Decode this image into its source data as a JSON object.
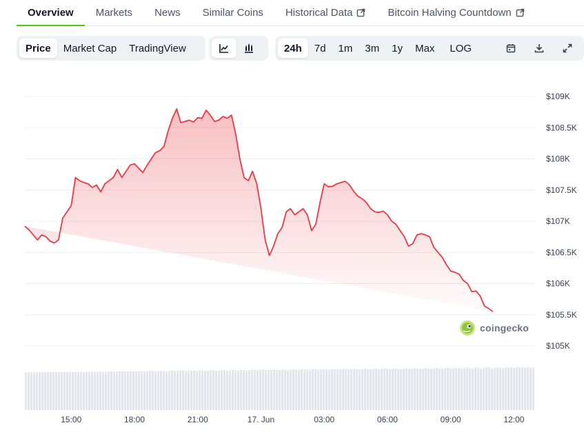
{
  "tabs": [
    {
      "label": "Overview",
      "active": true,
      "external": false
    },
    {
      "label": "Markets",
      "active": false,
      "external": false
    },
    {
      "label": "News",
      "active": false,
      "external": false
    },
    {
      "label": "Similar Coins",
      "active": false,
      "external": false
    },
    {
      "label": "Historical Data",
      "active": false,
      "external": true
    },
    {
      "label": "Bitcoin Halving Countdown",
      "active": false,
      "external": true
    }
  ],
  "toolbar": {
    "metric_tabs": [
      {
        "label": "Price",
        "selected": true
      },
      {
        "label": "Market Cap",
        "selected": false
      },
      {
        "label": "TradingView",
        "selected": false
      }
    ],
    "chart_style_icons": [
      {
        "icon": "line-chart-icon",
        "selected": true
      },
      {
        "icon": "candlestick-chart-icon",
        "selected": false
      }
    ],
    "ranges": [
      {
        "label": "24h",
        "selected": true
      },
      {
        "label": "7d",
        "selected": false
      },
      {
        "label": "1m",
        "selected": false
      },
      {
        "label": "3m",
        "selected": false
      },
      {
        "label": "1y",
        "selected": false
      },
      {
        "label": "Max",
        "selected": false
      },
      {
        "label": "LOG",
        "selected": false
      }
    ],
    "action_icons": [
      "calendar-icon",
      "download-icon",
      "fullscreen-icon"
    ]
  },
  "watermark": {
    "text": "coingecko",
    "icon": "coingecko-logo-icon"
  },
  "colors": {
    "line": "#ea3943",
    "fill": "#ea3943",
    "volume": "#e3e6ea",
    "active_tab_underline": "#4bcc00"
  },
  "chart_data": {
    "type": "area",
    "y_axis": {
      "min": 105000,
      "max": 109000,
      "ticks": [
        109000,
        108500,
        108000,
        107500,
        107000,
        106500,
        106000,
        105500,
        105000
      ],
      "tick_labels": [
        "$109K",
        "$108.5K",
        "$108K",
        "$107.5K",
        "$107K",
        "$106.5K",
        "$106K",
        "$105.5K",
        "$105K"
      ],
      "position": "right"
    },
    "x_axis": {
      "range_hours": [
        0,
        24.2
      ],
      "tick_hours": [
        2.2,
        5.2,
        8.2,
        11.2,
        14.2,
        17.2,
        20.2,
        23.2
      ],
      "tick_labels": [
        "15:00",
        "18:00",
        "21:00",
        "17. Jun",
        "03:00",
        "06:00",
        "09:00",
        "12:00"
      ]
    },
    "grid": true,
    "price": {
      "x_hours": [
        0,
        0.2,
        0.4,
        0.6,
        0.8,
        1.0,
        1.2,
        1.4,
        1.6,
        1.8,
        2.0,
        2.2,
        2.4,
        2.6,
        2.8,
        3.0,
        3.2,
        3.4,
        3.6,
        3.8,
        4.0,
        4.2,
        4.4,
        4.6,
        4.8,
        5.0,
        5.2,
        5.4,
        5.6,
        5.8,
        6.0,
        6.2,
        6.4,
        6.6,
        6.8,
        7.0,
        7.2,
        7.4,
        7.6,
        7.8,
        8.0,
        8.2,
        8.4,
        8.6,
        8.8,
        9.0,
        9.2,
        9.4,
        9.6,
        9.8,
        10.0,
        10.2,
        10.4,
        10.6,
        10.8,
        11.0,
        11.2,
        11.4,
        11.6,
        11.8,
        12.0,
        12.2,
        12.4,
        12.6,
        12.8,
        13.0,
        13.2,
        13.4,
        13.6,
        13.8,
        14.0,
        14.2,
        14.4,
        14.6,
        14.8,
        15.0,
        15.2,
        15.4,
        15.6,
        15.8,
        16.0,
        16.2,
        16.4,
        16.6,
        16.8,
        17.0,
        17.2,
        17.4,
        17.6,
        17.8,
        18.0,
        18.2,
        18.4,
        18.6,
        18.8,
        19.0,
        19.2,
        19.4,
        19.6,
        19.8,
        20.0,
        20.2,
        20.4,
        20.6,
        20.8,
        21.0,
        21.2,
        21.4,
        21.6,
        21.8,
        22.0,
        22.2,
        22.4,
        22.6,
        22.8,
        23.0,
        23.2,
        23.4,
        23.6,
        23.8,
        24.0,
        24.2
      ],
      "values": [
        106920,
        106860,
        106780,
        106700,
        106780,
        106750,
        106680,
        106650,
        106700,
        107050,
        107150,
        107250,
        107700,
        107650,
        107620,
        107600,
        107540,
        107580,
        107470,
        107600,
        107650,
        107700,
        107830,
        107700,
        107800,
        107900,
        107920,
        107850,
        107780,
        107900,
        108000,
        108100,
        108130,
        108200,
        108450,
        108650,
        108800,
        108580,
        108600,
        108620,
        108590,
        108660,
        108650,
        108780,
        108700,
        108600,
        108620,
        108680,
        108650,
        108700,
        108400,
        108000,
        107700,
        107650,
        107800,
        107600,
        107200,
        106700,
        106450,
        106600,
        106800,
        106900,
        107150,
        107200,
        107100,
        107150,
        107200,
        107100,
        106850,
        106950,
        107300,
        107600,
        107550,
        107560,
        107600,
        107620,
        107640,
        107580,
        107480,
        107400,
        107360,
        107300,
        107200,
        107150,
        107140,
        107160,
        107100,
        107000,
        106950,
        106850,
        106750,
        106600,
        106640,
        106780,
        106800,
        106780,
        106750,
        106580,
        106500,
        106420,
        106300,
        106200,
        106180,
        106150,
        106050,
        106000,
        105870,
        105880,
        105800,
        105640,
        105600,
        105550
      ]
    },
    "volume": {
      "x_hours": [
        0,
        24.2
      ],
      "relative_range": [
        0.78,
        0.96
      ]
    }
  }
}
